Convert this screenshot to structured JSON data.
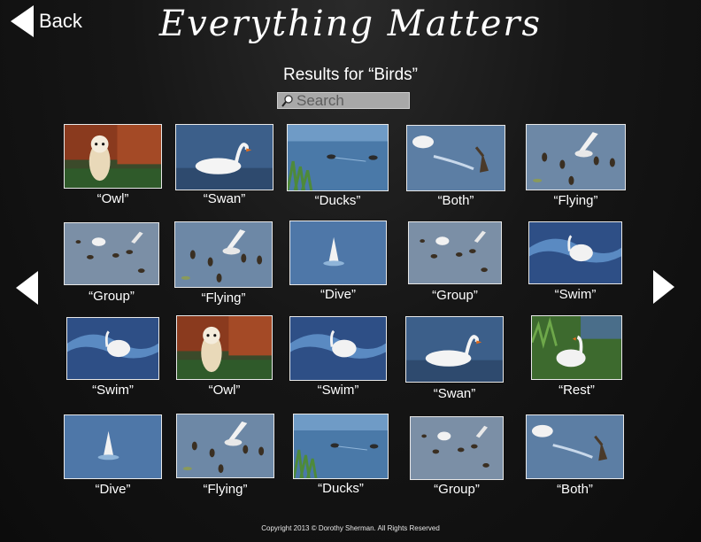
{
  "nav": {
    "back_label": "Back"
  },
  "header": {
    "title": "Everything Matters",
    "subtitle": "Results for “Birds”"
  },
  "search": {
    "placeholder": "Search",
    "icon": "magnifier-icon"
  },
  "results": [
    {
      "caption": "“Owl”",
      "scene": "owl"
    },
    {
      "caption": "“Swan”",
      "scene": "swan"
    },
    {
      "caption": "“Ducks”",
      "scene": "ducks"
    },
    {
      "caption": "“Both”",
      "scene": "both"
    },
    {
      "caption": "“Flying”",
      "scene": "flying"
    },
    {
      "caption": "“Group”",
      "scene": "group"
    },
    {
      "caption": "“Flying”",
      "scene": "flying"
    },
    {
      "caption": "“Dive”",
      "scene": "dive"
    },
    {
      "caption": "“Group”",
      "scene": "group"
    },
    {
      "caption": "“Swim”",
      "scene": "swim"
    },
    {
      "caption": "“Swim”",
      "scene": "swim"
    },
    {
      "caption": "“Owl”",
      "scene": "owl"
    },
    {
      "caption": "“Swim”",
      "scene": "swim"
    },
    {
      "caption": "“Swan”",
      "scene": "swan"
    },
    {
      "caption": "“Rest”",
      "scene": "rest"
    },
    {
      "caption": "“Dive”",
      "scene": "dive"
    },
    {
      "caption": "“Flying”",
      "scene": "flying"
    },
    {
      "caption": "“Ducks”",
      "scene": "ducks"
    },
    {
      "caption": "“Group”",
      "scene": "group"
    },
    {
      "caption": "“Both”",
      "scene": "both"
    }
  ],
  "pager": {
    "prev_icon": "triangle-left-icon",
    "next_icon": "triangle-right-icon"
  },
  "footer": {
    "copyright": "Copyright 2013 © Dorothy Sherman. All Rights Reserved"
  }
}
